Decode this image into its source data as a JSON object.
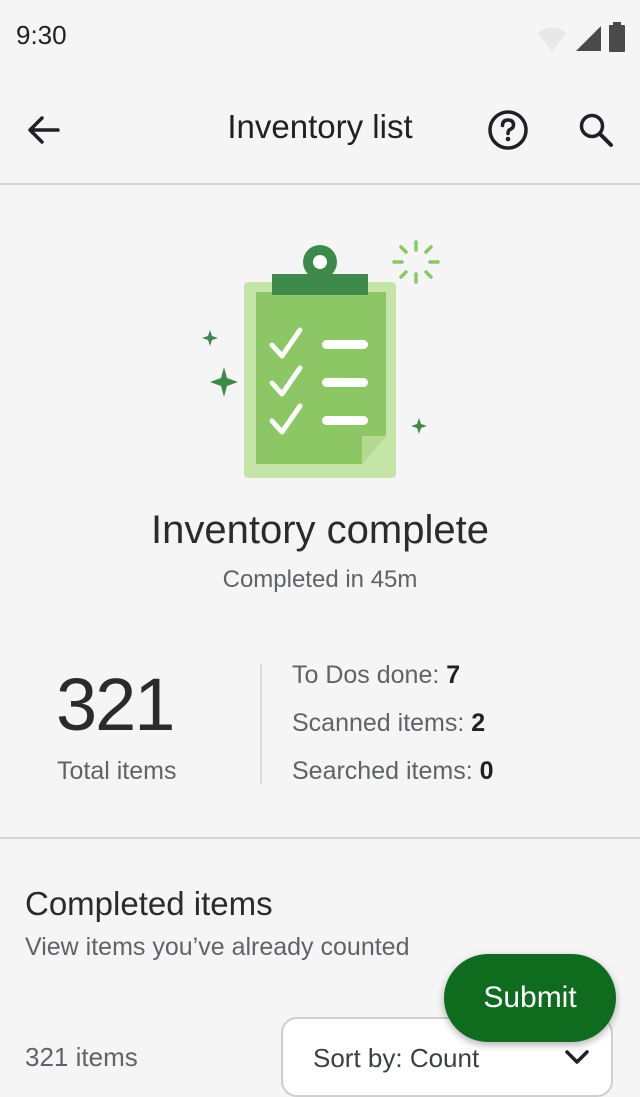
{
  "status": {
    "time": "9:30"
  },
  "appbar": {
    "title": "Inventory list"
  },
  "summary": {
    "title": "Inventory complete",
    "subtitle": "Completed in 45m",
    "total_number": "321",
    "total_label": "Total items",
    "stats": [
      {
        "label": "To Dos done: ",
        "value": "7"
      },
      {
        "label": "Scanned items: ",
        "value": "2"
      },
      {
        "label": "Searched items: ",
        "value": "0"
      }
    ]
  },
  "completed": {
    "title": "Completed items",
    "subtitle": "View items you’ve already counted",
    "count_label": "321 items",
    "sort_label": "Sort by: Count"
  },
  "submit_label": "Submit",
  "colors": {
    "accent": "#0f6b1e",
    "illustration_green": "#8cc665",
    "dark_green": "#3d8a4a"
  }
}
